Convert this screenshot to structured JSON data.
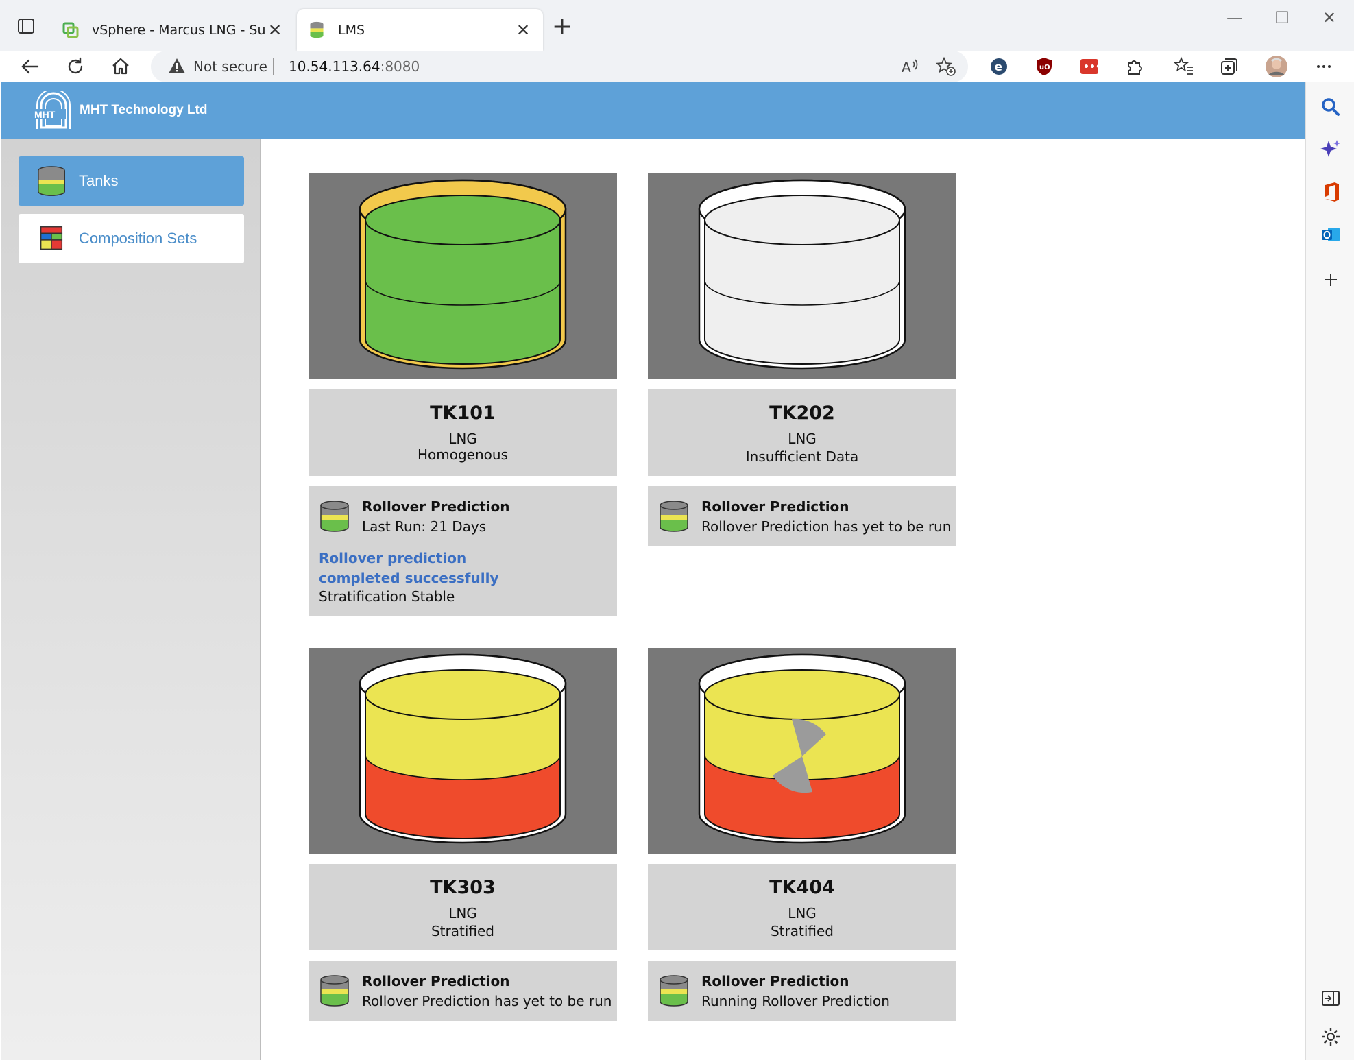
{
  "browser": {
    "tabs": [
      {
        "title": "vSphere - Marcus LNG - Summar",
        "active": false
      },
      {
        "title": "LMS",
        "active": true
      }
    ],
    "address": {
      "security_label": "Not secure",
      "host": "10.54.113.64",
      "port": ":8080"
    }
  },
  "app": {
    "brand": "MHT Technology Ltd",
    "logo_text": "MHT",
    "nav": [
      {
        "label": "Tanks",
        "active": true
      },
      {
        "label": "Composition Sets",
        "active": false
      }
    ]
  },
  "tanks": [
    {
      "name": "TK101",
      "type": "LNG",
      "status": "Homogenous",
      "layers": [
        "#6abf4b",
        "#6abf4b"
      ],
      "rim": "#f2c94c",
      "prediction": {
        "title": "Rollover Prediction",
        "line": "Last Run: 21 Days",
        "result": "Rollover prediction completed successfully",
        "detail": "Stratification Stable"
      }
    },
    {
      "name": "TK202",
      "type": "LNG",
      "status": "Insufficient Data",
      "layers": [
        "#efefef",
        "#efefef"
      ],
      "rim": "#ffffff",
      "prediction": {
        "title": "Rollover Prediction",
        "line": "Rollover Prediction has yet to be run"
      }
    },
    {
      "name": "TK303",
      "type": "LNG",
      "status": "Stratified",
      "layers": [
        "#ebe452",
        "#ef4b2c"
      ],
      "rim": "#ffffff",
      "prediction": {
        "title": "Rollover Prediction",
        "line": "Rollover Prediction has yet to be run"
      }
    },
    {
      "name": "TK404",
      "type": "LNG",
      "status": "Stratified",
      "layers": [
        "#ebe452",
        "#ef4b2c"
      ],
      "rim": "#ffffff",
      "running": true,
      "prediction": {
        "title": "Rollover Prediction",
        "line": "Running Rollover Prediction"
      }
    }
  ],
  "colors": {
    "header": "#5ea1d8",
    "tile_bg": "#787878",
    "info_bg": "#d4d4d4",
    "link": "#3b6fc3"
  }
}
